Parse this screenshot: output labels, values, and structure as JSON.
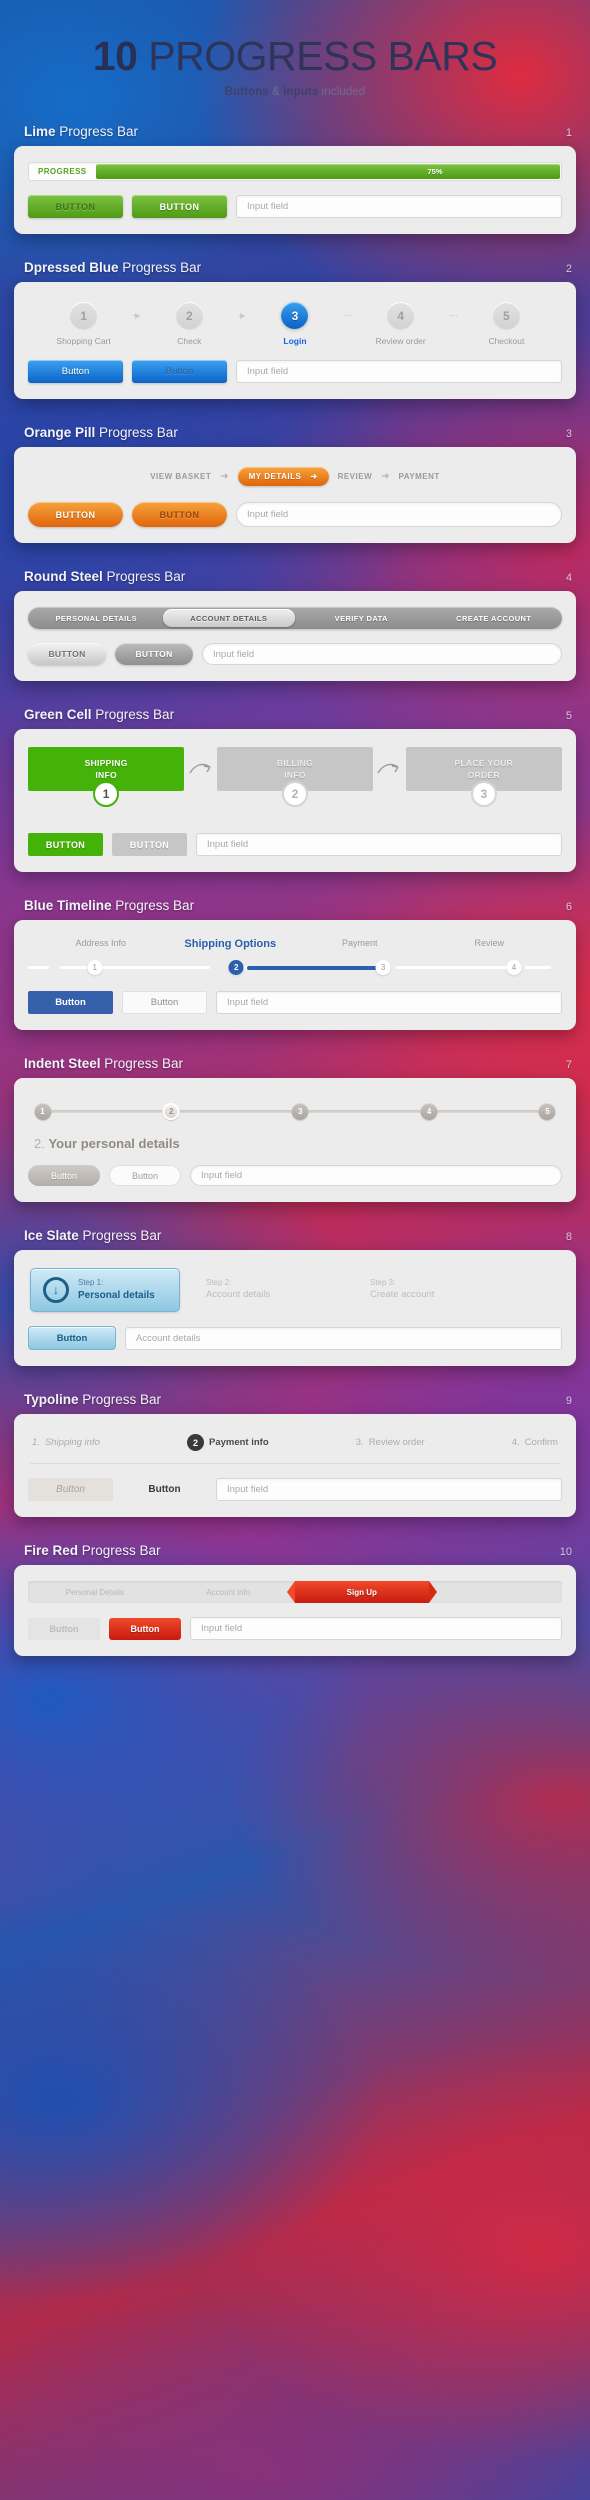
{
  "hero": {
    "title_bold": "10",
    "title_rest": " PROGRESS BARS",
    "sub_b1": "Buttons",
    "sub_amp": " & ",
    "sub_b2": "Inputs",
    "sub_rest": " included"
  },
  "sections": [
    {
      "num": "1",
      "title_bold": "Lime",
      "title_rest": " Progress Bar",
      "progress_label": "PROGRESS",
      "percent": "75%",
      "percent_value": 75,
      "btn1": "BUTTON",
      "btn2": "BUTTON",
      "input_placeholder": "Input field"
    },
    {
      "num": "2",
      "title_bold": "Dpressed Blue",
      "title_rest": " Progress Bar",
      "steps": [
        {
          "n": "1",
          "label": "Shopping Cart",
          "active": false
        },
        {
          "n": "2",
          "label": "Check",
          "active": false
        },
        {
          "n": "3",
          "label": "Login",
          "active": true
        },
        {
          "n": "4",
          "label": "Review order",
          "active": false
        },
        {
          "n": "5",
          "label": "Checkout",
          "active": false
        }
      ],
      "btn1": "Button",
      "btn2": "Button",
      "input_placeholder": "Input field"
    },
    {
      "num": "3",
      "title_bold": "Orange Pill",
      "title_rest": " Progress Bar",
      "steps": [
        {
          "label": "VIEW BASKET",
          "active": false
        },
        {
          "label": "MY DETAILS",
          "active": true
        },
        {
          "label": "REVIEW",
          "active": false
        },
        {
          "label": "PAYMENT",
          "active": false
        }
      ],
      "separator": "➜",
      "btn1": "BUTTON",
      "btn2": "BUTTON",
      "input_placeholder": "Input field"
    },
    {
      "num": "4",
      "title_bold": "Round Steel",
      "title_rest": " Progress Bar",
      "steps": [
        {
          "label": "PERSONAL DETAILS",
          "active": false
        },
        {
          "label": "ACCOUNT DETAILS",
          "active": true
        },
        {
          "label": "VERIFY DATA",
          "active": false
        },
        {
          "label": "CREATE ACCOUNT",
          "active": false
        }
      ],
      "btn1": "BUTTON",
      "btn2": "BUTTON",
      "input_placeholder": "Input field"
    },
    {
      "num": "5",
      "title_bold": "Green Cell",
      "title_rest": " Progress Bar",
      "steps": [
        {
          "l1": "SHIPPING",
          "l2": "INFO",
          "n": "1",
          "active": true
        },
        {
          "l1": "BILLING",
          "l2": "INFO",
          "n": "2",
          "active": false
        },
        {
          "l1": "PLACE YOUR",
          "l2": "ORDER",
          "n": "3",
          "active": false
        }
      ],
      "btn1": "BUTTON",
      "btn2": "BUTTON",
      "input_placeholder": "Input field"
    },
    {
      "num": "6",
      "title_bold": "Blue Timeline",
      "title_rest": " Progress Bar",
      "steps": [
        {
          "n": "1",
          "label": "Address Info",
          "active": false
        },
        {
          "n": "2",
          "label": "Shipping Options",
          "active": true
        },
        {
          "n": "3",
          "label": "Payment",
          "active": false
        },
        {
          "n": "4",
          "label": "Review",
          "active": false
        }
      ],
      "btn1": "Button",
      "btn2": "Button",
      "input_placeholder": "Input field"
    },
    {
      "num": "7",
      "title_bold": "Indent Steel",
      "title_rest": " Progress Bar",
      "steps": [
        {
          "n": "1",
          "active": false
        },
        {
          "n": "2",
          "active": true
        },
        {
          "n": "3",
          "active": false
        },
        {
          "n": "4",
          "active": false
        },
        {
          "n": "5",
          "active": false
        }
      ],
      "headline_num": "2.",
      "headline_text": "Your personal details",
      "btn1": "Button",
      "btn2": "Button",
      "input_placeholder": "Input field"
    },
    {
      "num": "8",
      "title_bold": "Ice Slate",
      "title_rest": " Progress Bar",
      "steps": [
        {
          "t1": "Step 1:",
          "t2": "Personal details",
          "active": true
        },
        {
          "t1": "Step 2:",
          "t2": "Account details",
          "active": false
        },
        {
          "t1": "Step 3:",
          "t2": "Create account",
          "active": false
        }
      ],
      "btn1": "Button",
      "input_placeholder": "Account details"
    },
    {
      "num": "9",
      "title_bold": "Typoline",
      "title_rest": " Progress Bar",
      "steps": [
        {
          "n": "1.",
          "label": "Shipping info",
          "active": false,
          "badge": false
        },
        {
          "n": "2",
          "label": "Payment info",
          "active": true,
          "badge": true
        },
        {
          "n": "3.",
          "label": "Review order",
          "active": false,
          "badge": false
        },
        {
          "n": "4.",
          "label": "Confirm",
          "active": false,
          "badge": false
        }
      ],
      "btn1": "Button",
      "btn2": "Button",
      "input_placeholder": "Input field"
    },
    {
      "num": "10",
      "title_bold": "Fire Red",
      "title_rest": " Progress Bar",
      "steps": [
        {
          "label": "Personal Details",
          "active": false
        },
        {
          "label": "Account info",
          "active": false
        },
        {
          "label": "Sign Up",
          "active": true
        },
        {
          "label": "",
          "active": false
        }
      ],
      "btn1": "Button",
      "btn2": "Button",
      "input_placeholder": "Input field"
    }
  ],
  "colors": {
    "lime": "#5aa01e",
    "blue": "#0b63c8",
    "orange": "#e0650c",
    "steel": "#8d8d8d",
    "green": "#45b209",
    "timeline_blue": "#2c5fae",
    "indent": "#b3aea9",
    "ice": "#1c5f87",
    "typo": "#3a3a3a",
    "fire": "#c81a10"
  }
}
